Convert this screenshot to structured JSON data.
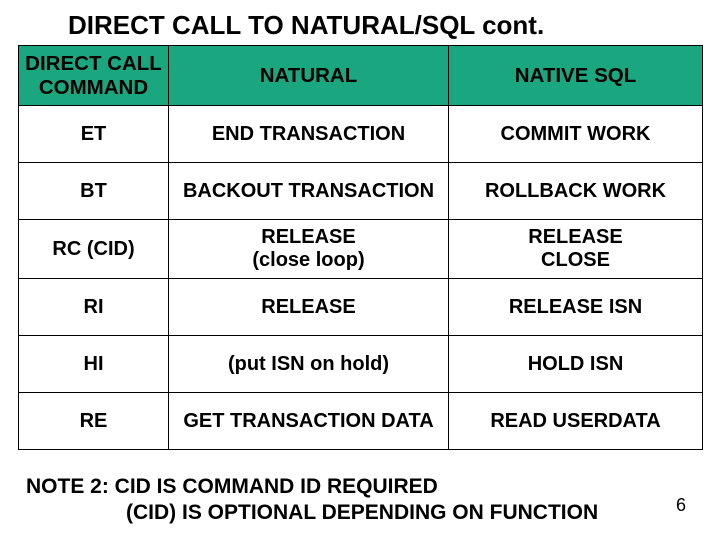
{
  "title": "DIRECT CALL TO NATURAL/SQL cont.",
  "headers": {
    "col1_line1": "DIRECT CALL",
    "col1_line2": "COMMAND",
    "col2": "NATURAL",
    "col3": "NATIVE SQL"
  },
  "rows": [
    {
      "cmd": "ET",
      "natural": "END TRANSACTION",
      "sql": "COMMIT WORK"
    },
    {
      "cmd": "BT",
      "natural": "BACKOUT TRANSACTION",
      "sql": "ROLLBACK WORK"
    },
    {
      "cmd": "RC (CID)",
      "natural_l1": "RELEASE",
      "natural_l2": "(close loop)",
      "sql_l1": "RELEASE",
      "sql_l2": "CLOSE"
    },
    {
      "cmd": "RI",
      "natural": "RELEASE",
      "sql": "RELEASE ISN"
    },
    {
      "cmd": "HI",
      "natural": "(put ISN on hold)",
      "sql": "HOLD ISN"
    },
    {
      "cmd": "RE",
      "natural": "GET TRANSACTION DATA",
      "sql": "READ USERDATA"
    }
  ],
  "note_line1": "NOTE 2:  CID  IS COMMAND ID REQUIRED",
  "note_line2": "(CID) IS OPTIONAL DEPENDING ON FUNCTION",
  "page_number": "6"
}
